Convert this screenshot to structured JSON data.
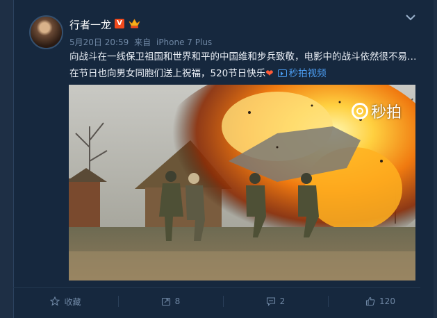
{
  "post": {
    "username": "行者一龙",
    "verified_badge": "V",
    "meta": {
      "date": "5月20日 20:59",
      "source_prefix": "来自",
      "source": "iPhone 7 Plus"
    },
    "text": "向战斗在一线保卫祖国和世界和平的中国维和步兵致敬，电影中的战斗依然很不易…在节日也向男女同胞们送上祝福，520节日快乐",
    "heart_emoji": "❤",
    "video_link_label": "秒拍视频",
    "watermark": "秒拍"
  },
  "actions": {
    "favorite_label": "收藏",
    "repost_count": "8",
    "comment_count": "2",
    "like_count": "120"
  },
  "icons": [
    "crown-icon",
    "chevron-down-icon",
    "star-icon",
    "repost-icon",
    "comment-icon",
    "like-icon"
  ],
  "colors": {
    "background": "#1e2f45",
    "card": "#16283e",
    "link": "#4b9cf0",
    "meta": "#6f87a4",
    "verified": "#f04a1d"
  }
}
